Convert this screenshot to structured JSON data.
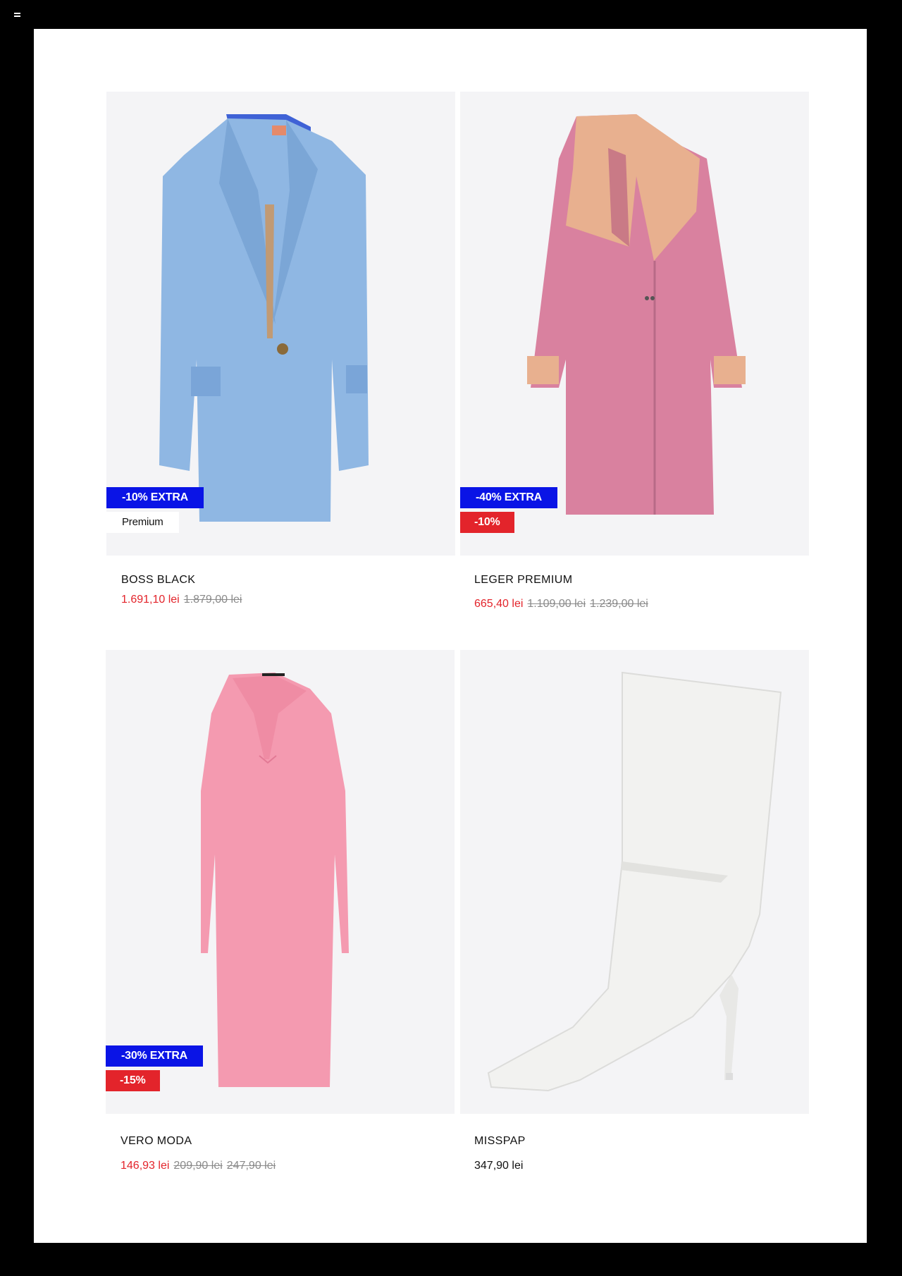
{
  "products": [
    {
      "brand": "BOSS BLACK",
      "badges": {
        "extra": "-10% EXTRA",
        "second": "Premium"
      },
      "price_now": "1.691,10 lei",
      "price_old_1": "1.879,00 lei",
      "image": "light-blue-blazer"
    },
    {
      "brand": "LEGER PREMIUM",
      "badges": {
        "extra": "-40% EXTRA",
        "second": "-10%"
      },
      "price_now": "665,40 lei",
      "price_old_1": "1.109,00 lei",
      "price_old_2": "1.239,00 lei",
      "image": "pink-coat"
    },
    {
      "brand": "VERO MODA",
      "badges": {
        "extra": "-30% EXTRA",
        "second": "-15%"
      },
      "price_now": "146,93 lei",
      "price_old_1": "209,90 lei",
      "price_old_2": "247,90 lei",
      "image": "pink-knit-dress"
    },
    {
      "brand": "MISSPAP",
      "price_regular": "347,90 lei",
      "image": "white-boot"
    }
  ],
  "colors": {
    "extra_badge": "#0a14e6",
    "discount": "#e3242b",
    "background": "#000000",
    "page": "#ffffff"
  }
}
